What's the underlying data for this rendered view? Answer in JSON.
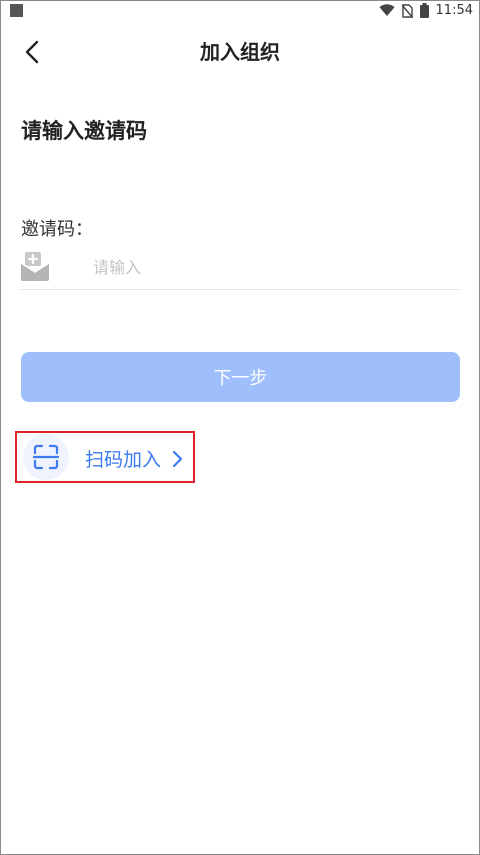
{
  "status_bar": {
    "time": "11:54"
  },
  "header": {
    "title": "加入组织"
  },
  "form": {
    "heading": "请输入邀请码",
    "code_label": "邀请码：",
    "code_value": "",
    "code_placeholder": "请输入",
    "next_label": "下一步"
  },
  "scan": {
    "label": "扫码加入"
  },
  "colors": {
    "accent": "#3d7bf0",
    "button_disabled": "#9ebffb",
    "highlight_border": "#e0242b"
  }
}
